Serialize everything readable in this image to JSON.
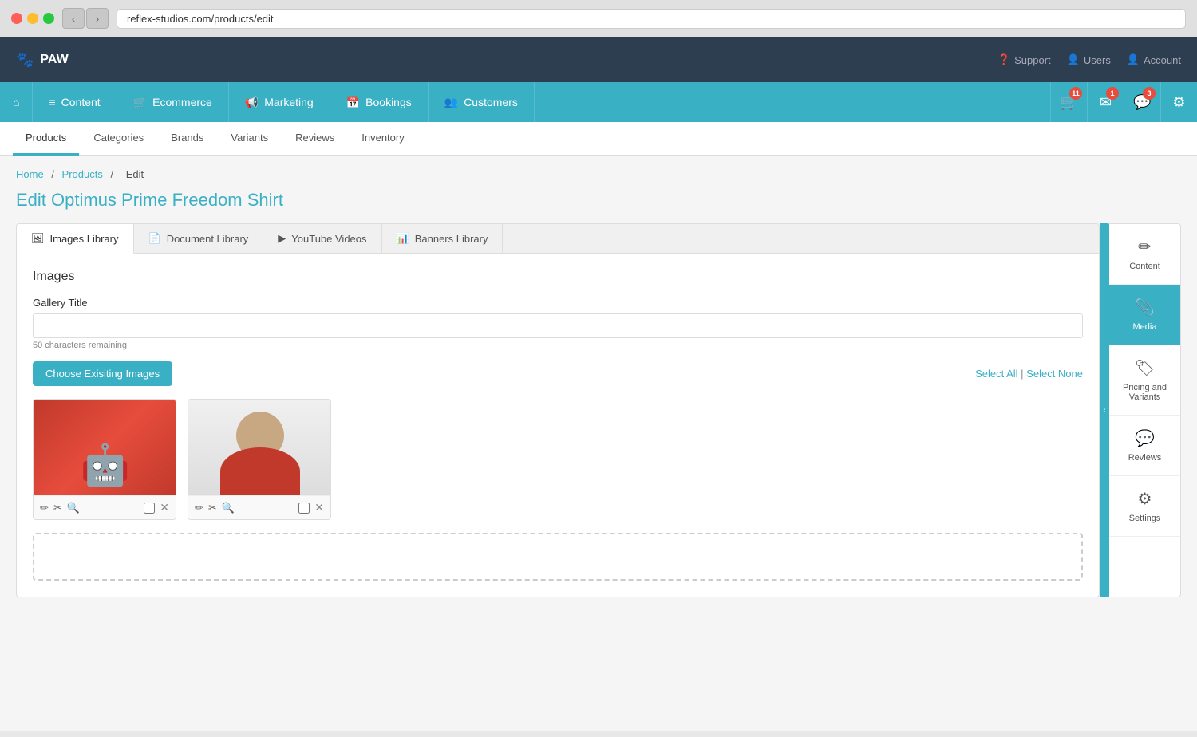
{
  "browser": {
    "url": "reflex-studios.com/products/edit",
    "back_label": "‹",
    "forward_label": "›"
  },
  "app_header": {
    "logo": "PAW",
    "logo_icon": "🐾",
    "support_label": "Support",
    "users_label": "Users",
    "account_label": "Account"
  },
  "nav": {
    "home_icon": "⌂",
    "items": [
      {
        "label": "Content",
        "icon": "≡"
      },
      {
        "label": "Ecommerce",
        "icon": "🛒"
      },
      {
        "label": "Marketing",
        "icon": "📢"
      },
      {
        "label": "Bookings",
        "icon": "📅"
      },
      {
        "label": "Customers",
        "icon": "👥"
      }
    ],
    "actions": [
      {
        "icon": "🛒",
        "badge": "11",
        "name": "cart"
      },
      {
        "icon": "✉",
        "badge": "1",
        "name": "mail"
      },
      {
        "icon": "💬",
        "badge": "3",
        "name": "chat"
      },
      {
        "icon": "⚙",
        "badge": null,
        "name": "settings"
      }
    ]
  },
  "sub_tabs": [
    {
      "label": "Products",
      "active": true
    },
    {
      "label": "Categories"
    },
    {
      "label": "Brands"
    },
    {
      "label": "Variants"
    },
    {
      "label": "Reviews"
    },
    {
      "label": "Inventory"
    }
  ],
  "breadcrumb": {
    "home": "Home",
    "section": "Products",
    "current": "Edit"
  },
  "page_title": "Edit Optimus Prime Freedom Shirt",
  "library_tabs": [
    {
      "label": "Images Library",
      "icon": "🖼",
      "active": true
    },
    {
      "label": "Document Library",
      "icon": "📄"
    },
    {
      "label": "YouTube Videos",
      "icon": "▶"
    },
    {
      "label": "Banners Library",
      "icon": "📊"
    }
  ],
  "images_section": {
    "title": "Images",
    "gallery_title_label": "Gallery Title",
    "gallery_title_placeholder": "",
    "char_count": "50 characters remaining",
    "choose_btn": "Choose Exisiting Images",
    "select_all": "Select All",
    "select_none": "Select None",
    "images": [
      {
        "type": "shirt",
        "id": "img1"
      },
      {
        "type": "person",
        "id": "img2"
      }
    ]
  },
  "right_sidebar": {
    "items": [
      {
        "label": "Content",
        "icon": "✏",
        "active": false
      },
      {
        "label": "Media",
        "icon": "📎",
        "active": true
      },
      {
        "label": "Pricing and\nVariants",
        "icon": "🏷",
        "active": false
      },
      {
        "label": "Reviews",
        "icon": "💬",
        "active": false
      },
      {
        "label": "Settings",
        "icon": "⚙",
        "active": false
      }
    ]
  },
  "colors": {
    "accent": "#3ab0c5",
    "header_bg": "#2c3e50",
    "nav_bg": "#3ab0c5"
  }
}
